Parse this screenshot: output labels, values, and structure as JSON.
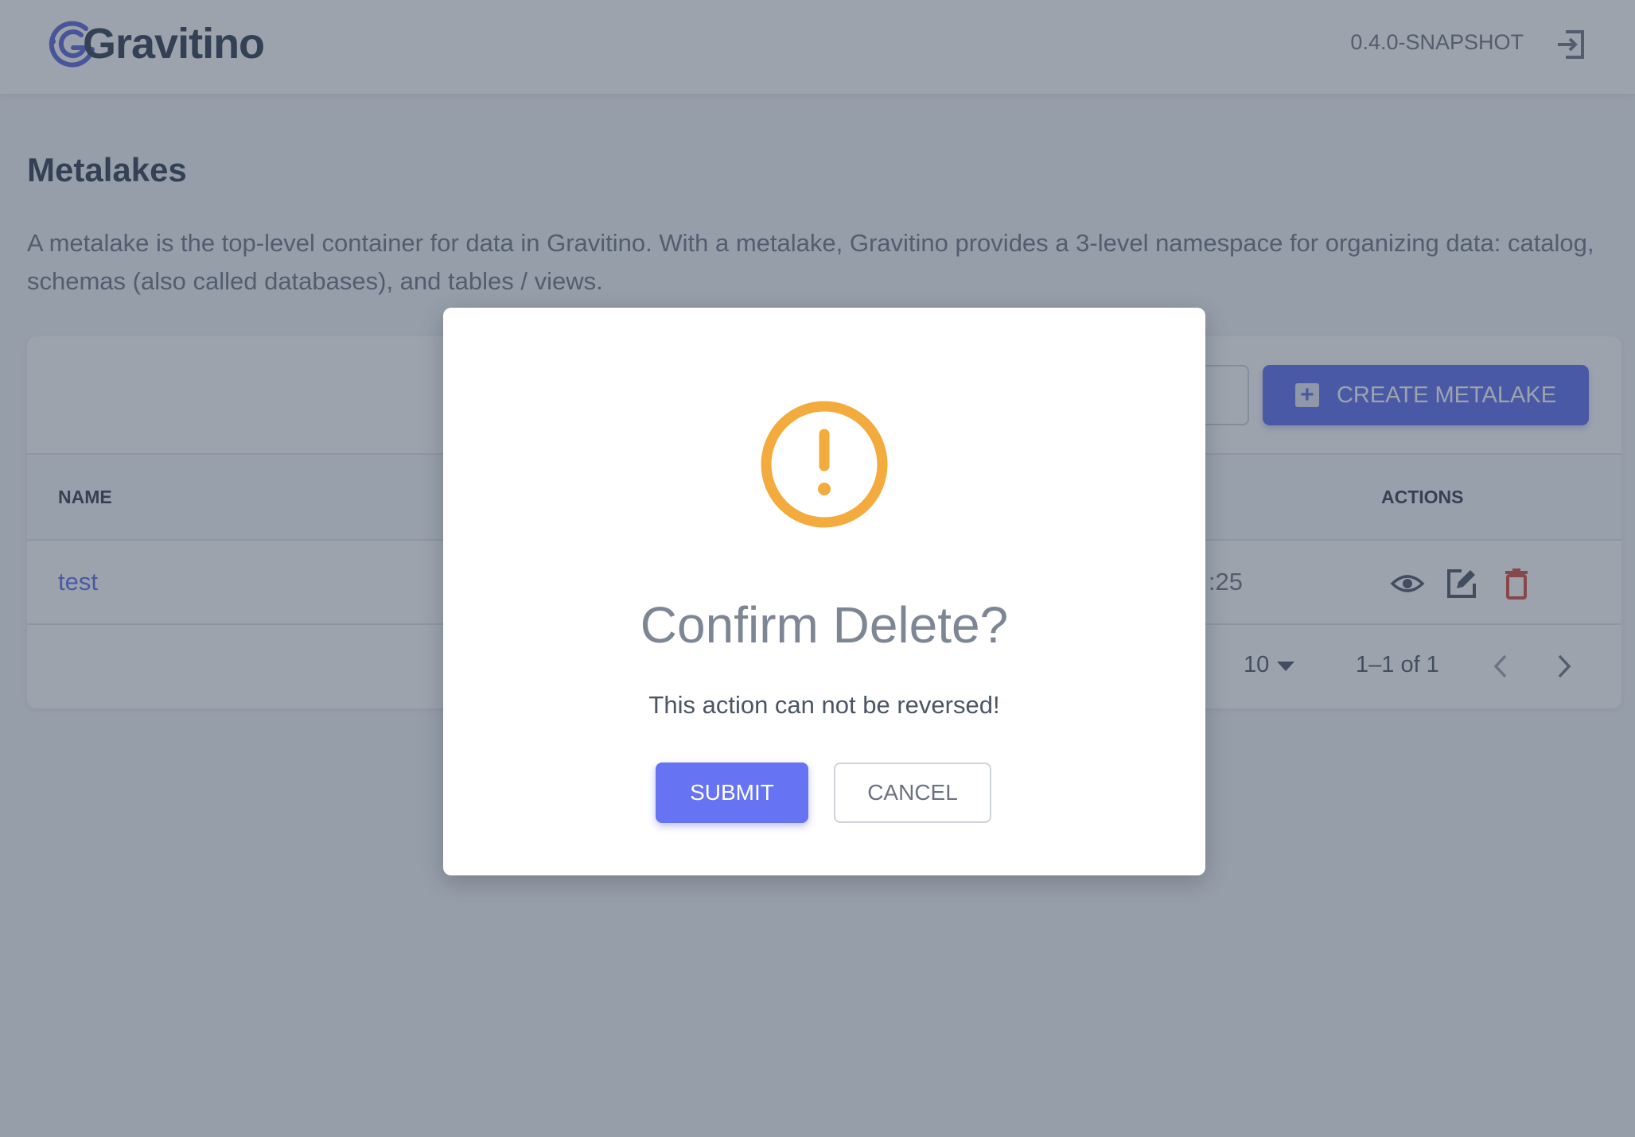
{
  "header": {
    "brand": "Gravitino",
    "version": "0.4.0-SNAPSHOT",
    "logo_icon": "gravitino-logo",
    "logout_icon": "logout-icon"
  },
  "page": {
    "title": "Metalakes",
    "description": "A metalake is the top-level container for data in Gravitino. With a metalake, Gravitino provides a 3-level namespace for organizing data: catalog, schemas (also called databases), and tables / views."
  },
  "toolbar": {
    "create_label": "CREATE METALAKE"
  },
  "table": {
    "columns": {
      "name": "NAME",
      "actions": "ACTIONS"
    },
    "rows": [
      {
        "name": "test",
        "created_partial": ":25"
      }
    ],
    "pagination": {
      "rows_per_page": "10",
      "range": "1–1 of 1"
    }
  },
  "dialog": {
    "title": "Confirm Delete?",
    "message": "This action can not be reversed!",
    "submit_label": "SUBMIT",
    "cancel_label": "CANCEL",
    "icon": "warning-icon",
    "icon_color": "#f2ab3c",
    "primary_color": "#6673f2"
  }
}
